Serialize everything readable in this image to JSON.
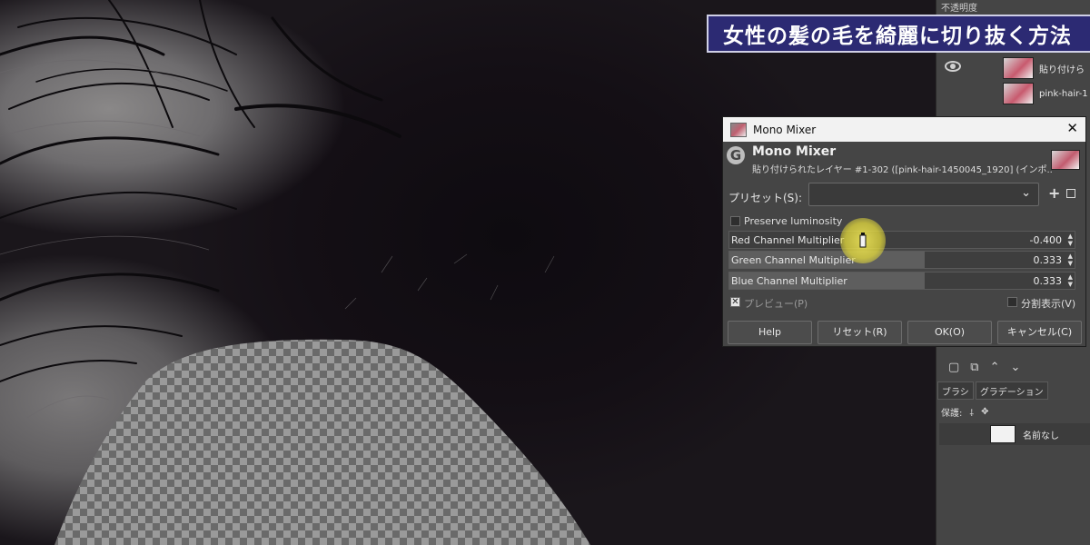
{
  "banner": {
    "title": "女性の髪の毛を綺麗に切り抜く方法"
  },
  "dock": {
    "opacity_label": "不透明度",
    "layers": [
      {
        "name": "貼り付けら"
      },
      {
        "name": "pink-hair-1"
      }
    ],
    "tabs": [
      "ブラシ",
      "グラデーション"
    ],
    "protect_label": "保護:",
    "brush_name": "名前なし"
  },
  "dialog": {
    "window_title": "Mono Mixer",
    "header_title": "Mono Mixer",
    "header_subtitle": "貼り付けられたレイヤー #1-302 ([pink-hair-1450045_1920] (インポ...",
    "preset_label": "プリセット(S):",
    "preserve_luminosity_label": "Preserve luminosity",
    "sliders": [
      {
        "label": "Red Channel Multiplier",
        "value": "-0.400",
        "fill": 0.0
      },
      {
        "label": "Green Channel Multiplier",
        "value": "0.333",
        "fill": 0.567
      },
      {
        "label": "Blue Channel Multiplier",
        "value": "0.333",
        "fill": 0.567
      }
    ],
    "preview_label": "プレビュー(P)",
    "split_view_label": "分割表示(V)",
    "buttons": {
      "help": "Help",
      "reset": "リセット(R)",
      "ok": "OK(O)",
      "cancel": "キャンセル(C)"
    }
  },
  "colors": {
    "banner_bg": "#2c2a73",
    "dialog_bg": "#454545",
    "cursor_highlight": "#e6dc3c"
  }
}
